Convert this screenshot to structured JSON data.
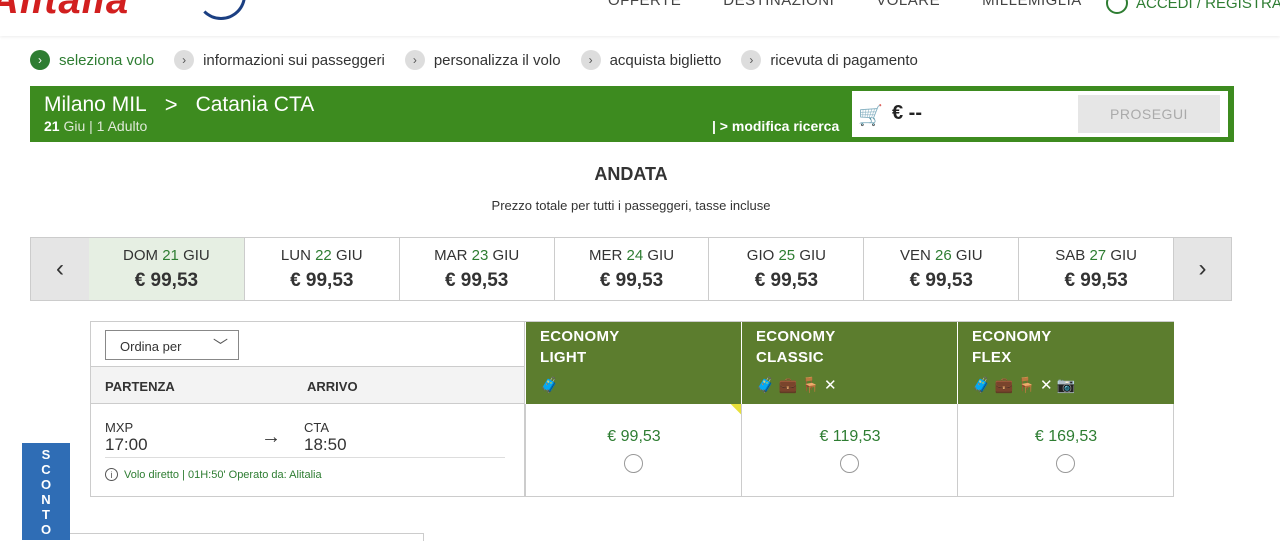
{
  "header": {
    "logo_text": "Alitalia",
    "nav": [
      "OFFERTE",
      "DESTINAZIONI",
      "VOLARE",
      "MILLEMIGLIA"
    ],
    "account_label": "ACCEDI / REGISTRA"
  },
  "steps": [
    {
      "label": "seleziona volo",
      "active": true
    },
    {
      "label": "informazioni sui passeggeri",
      "active": false
    },
    {
      "label": "personalizza il volo",
      "active": false
    },
    {
      "label": "acquista biglietto",
      "active": false
    },
    {
      "label": "ricevuta di pagamento",
      "active": false
    }
  ],
  "banner": {
    "origin": "Milano MIL",
    "separator": ">",
    "destination": "Catania CTA",
    "date_day": "21",
    "date_rest": "Giu | 1 Adulto",
    "modify": "| > modifica ricerca",
    "cart_price": "€ --",
    "continue_label": "PROSEGUI"
  },
  "section": {
    "title": "ANDATA",
    "subtitle": "Prezzo totale per tutti i passeggeri, tasse incluse"
  },
  "dates": [
    {
      "dow": "DOM",
      "day": "21",
      "month": "GIU",
      "price": "€ 99,53",
      "selected": true
    },
    {
      "dow": "LUN",
      "day": "22",
      "month": "GIU",
      "price": "€ 99,53",
      "selected": false
    },
    {
      "dow": "MAR",
      "day": "23",
      "month": "GIU",
      "price": "€ 99,53",
      "selected": false
    },
    {
      "dow": "MER",
      "day": "24",
      "month": "GIU",
      "price": "€ 99,53",
      "selected": false
    },
    {
      "dow": "GIO",
      "day": "25",
      "month": "GIU",
      "price": "€ 99,53",
      "selected": false
    },
    {
      "dow": "VEN",
      "day": "26",
      "month": "GIU",
      "price": "€ 99,53",
      "selected": false
    },
    {
      "dow": "SAB",
      "day": "27",
      "month": "GIU",
      "price": "€ 99,53",
      "selected": false
    }
  ],
  "table": {
    "sort_label": "Ordina per",
    "col_departure": "PARTENZA",
    "col_arrival": "ARRIVO",
    "fares": [
      {
        "line1": "ECONOMY",
        "line2": "LIGHT",
        "icons": "🧳",
        "price": "€ 99,53"
      },
      {
        "line1": "ECONOMY",
        "line2": "CLASSIC",
        "icons": "🧳💼🪑✕",
        "price": "€ 119,53"
      },
      {
        "line1": "ECONOMY",
        "line2": "FLEX",
        "icons": "🧳💼🪑✕📷",
        "price": "€ 169,53"
      }
    ],
    "flight": {
      "dep_code": "MXP",
      "dep_time": "17:00",
      "arr_code": "CTA",
      "arr_time": "18:50",
      "info": "Volo diretto | 01H:50' Operato da: Alitalia"
    }
  },
  "promo": {
    "letters": [
      "S",
      "C",
      "O",
      "N",
      "T",
      "O"
    ]
  },
  "colors": {
    "brand_green": "#3d8b1f",
    "fare_header": "#5c7d2e",
    "text_green": "#2e7d32",
    "promo_blue": "#2f6db5"
  }
}
